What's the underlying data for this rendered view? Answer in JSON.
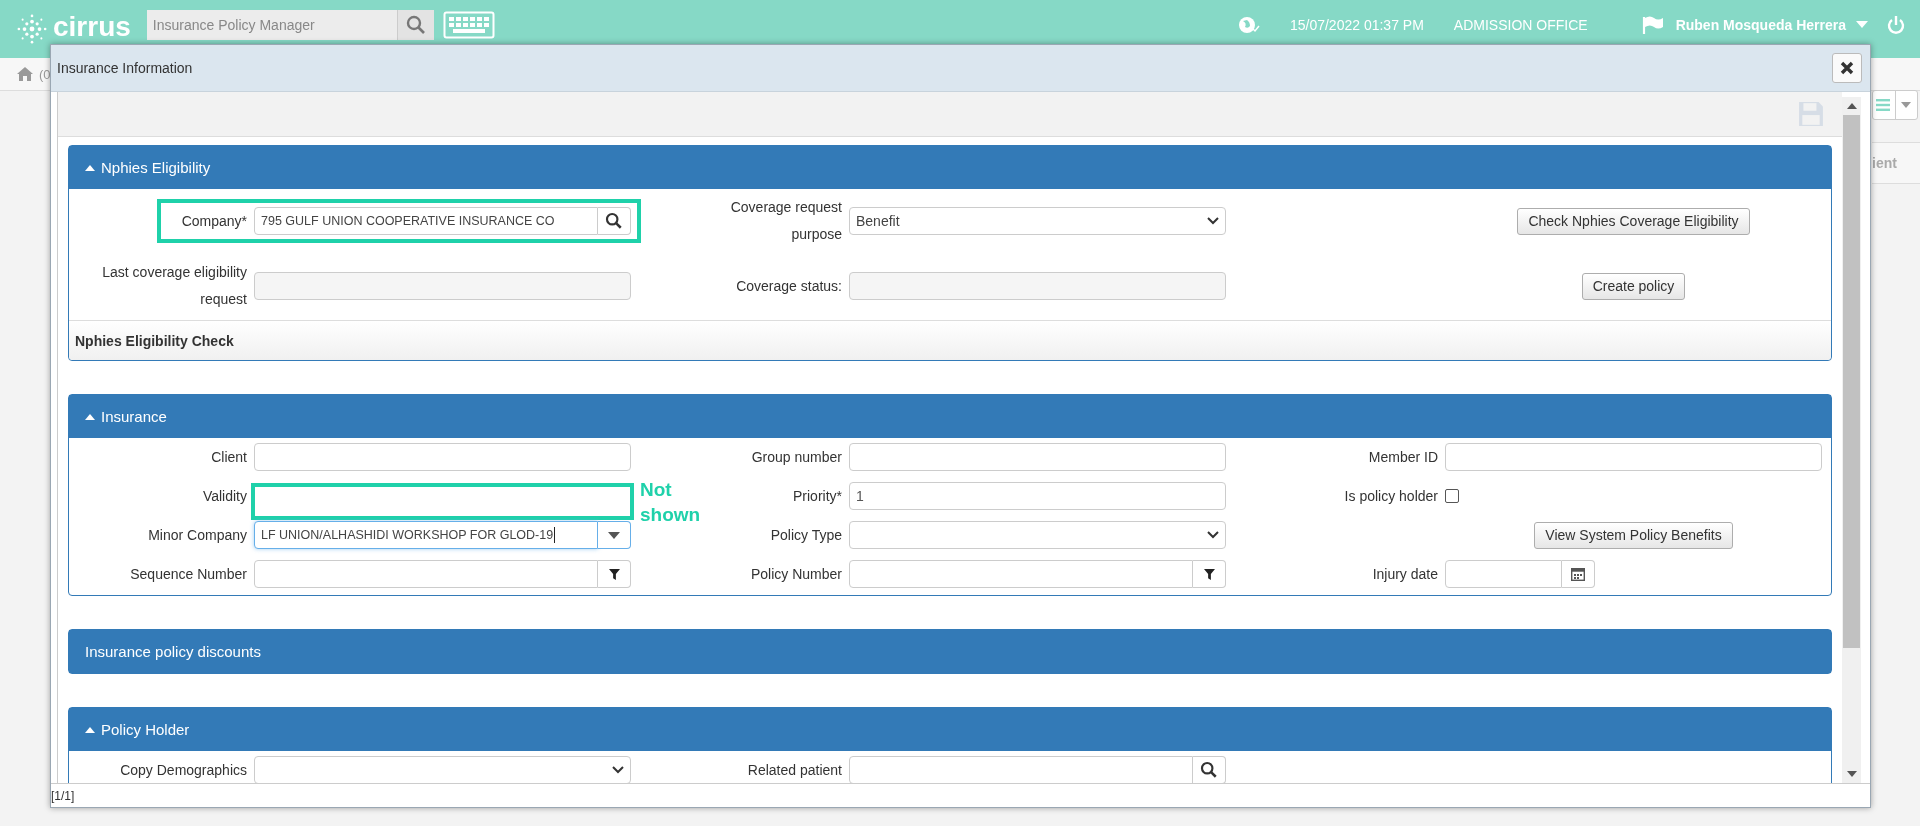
{
  "app": {
    "logo": "cirrus",
    "search": {
      "placeholder": "Insurance Policy Manager"
    },
    "datetime": "15/07/2022 01:37 PM",
    "location": "ADMISSION OFFICE",
    "user": "Ruben Mosqueda Herrera"
  },
  "background": {
    "breadcrumb": "(0",
    "column_header": "ient"
  },
  "dialog": {
    "title": "Insurance Information",
    "footer": "[1/1]",
    "sections": [
      {
        "title": "Nphies Eligibility",
        "expanded": true,
        "rows": [
          [
            {
              "label": "Company*",
              "kind": "lookup",
              "value": "795 GULF UNION COOPERATIVE INSURANCE CO",
              "highlight": true
            },
            {
              "label": "Coverage request purpose",
              "kind": "select",
              "value": "Benefit"
            },
            {
              "kind": "button",
              "value": "Check Nphies Coverage Eligibility"
            }
          ],
          [
            {
              "label": "Last coverage eligibility request",
              "kind": "text",
              "disabled": true
            },
            {
              "label": "Coverage status:",
              "kind": "text",
              "disabled": true
            },
            {
              "kind": "button",
              "value": "Create policy"
            }
          ]
        ],
        "subpanel": "Nphies Eligibility Check"
      },
      {
        "title": "Insurance",
        "expanded": true,
        "rows": [
          [
            {
              "label": "Client",
              "kind": "text",
              "disabled": false
            },
            {
              "label": "Group number",
              "kind": "text",
              "disabled": false
            },
            {
              "label": "Member ID",
              "kind": "text",
              "disabled": false
            }
          ],
          [
            {
              "label": "Validity",
              "kind": "hidden",
              "highlight": true,
              "note": "Not shown"
            },
            {
              "label": "Priority*",
              "kind": "text",
              "value": "1",
              "disabled": false
            },
            {
              "label": "Is policy holder",
              "kind": "checkbox",
              "checked": false
            }
          ],
          [
            {
              "label": "Minor Company",
              "kind": "combo",
              "value": "LF UNION/ALHASHIDI WORKSHOP FOR GLOD-19",
              "focused": true
            },
            {
              "label": "Policy Type",
              "kind": "select"
            },
            {
              "kind": "button",
              "value": "View System Policy Benefits"
            }
          ],
          [
            {
              "label": "Sequence Number",
              "kind": "filter"
            },
            {
              "label": "Policy Number",
              "kind": "filter"
            },
            {
              "label": "Injury date",
              "kind": "date"
            }
          ]
        ]
      },
      {
        "title": "Insurance policy discounts",
        "expanded": false
      },
      {
        "title": "Policy Holder",
        "expanded": true,
        "rows": [
          [
            {
              "label": "Copy Demographics",
              "kind": "select"
            },
            {
              "label": "Related patient",
              "kind": "lookup"
            }
          ]
        ]
      }
    ]
  }
}
